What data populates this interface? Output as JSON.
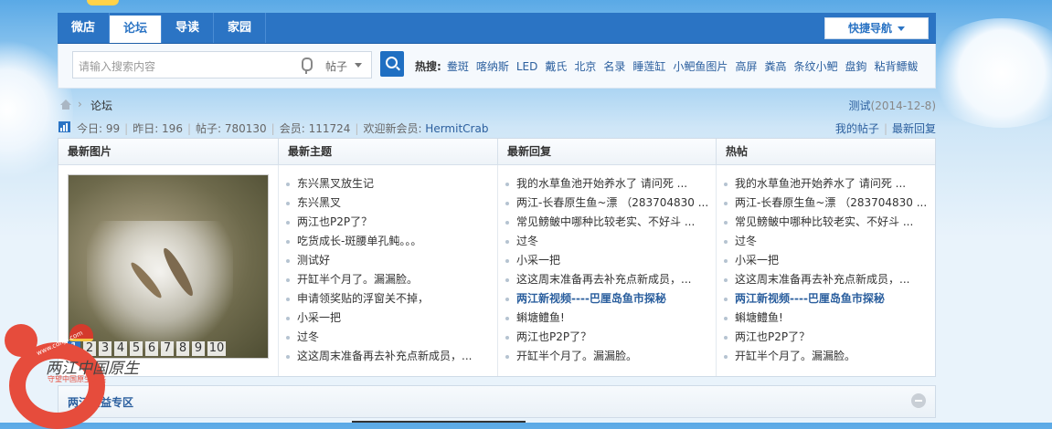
{
  "nav": {
    "tabs": [
      {
        "label": "微店"
      },
      {
        "label": "论坛",
        "active": true
      },
      {
        "label": "导读"
      },
      {
        "label": "家园"
      }
    ],
    "quick_nav": "快捷导航"
  },
  "search": {
    "placeholder": "请输入搜索内容",
    "scope": "帖子",
    "hot_label": "热搜:",
    "hot": [
      "鲞斑",
      "喀纳斯",
      "LED",
      "戴氏",
      "北京",
      "名录",
      "睡莲缸",
      "小鲃鱼图片",
      "高屏",
      "粪高",
      "条纹小鲃",
      "盘鉤",
      "粘背鳔鲅"
    ]
  },
  "breadcrumb": {
    "current": "论坛",
    "right_text": "测试",
    "right_date": "(2014-12-8)"
  },
  "stats": {
    "today": "今日: 99",
    "yesterday": "昨日: 196",
    "posts": "帖子: 780130",
    "members": "会员: 111724",
    "welcome": "欢迎新会员: ",
    "new_member": "HermitCrab",
    "my_posts": "我的帖子",
    "latest_reply": "最新回复"
  },
  "panel": {
    "headers": [
      "最新图片",
      "最新主题",
      "最新回复",
      "热帖"
    ],
    "pager": [
      "1",
      "2",
      "3",
      "4",
      "5",
      "6",
      "7",
      "8",
      "9",
      "10"
    ],
    "latest_topics": [
      "东兴黑叉放生记",
      "东兴黑叉",
      "两江也P2P了？",
      "吃货成长-斑腰单孔鲀。。。",
      "测试好",
      "开缸半个月了。漏漏脸。",
      "申请领奖贴的浮窗关不掉，",
      "小采一把",
      "过冬",
      "这这周末准备再去补充点新成员，..."
    ],
    "latest_replies": [
      "我的水草鱼池开始养水了 请问死 ...",
      "两江-长春原生鱼~漂 （283704830 ...",
      "常见鳑鲏中哪种比较老实、不好斗 ...",
      "过冬",
      "小采一把",
      "这这周末准备再去补充点新成员，...",
      "两江新视频----巴厘岛鱼市探秘",
      "蝌塘鳢鱼!",
      "两江也P2P了？",
      "开缸半个月了。漏漏脸。"
    ],
    "hot_posts": [
      "我的水草鱼池开始养水了 请问死 ...",
      "两江-长春原生鱼~漂 （283704830 ...",
      "常见鳑鲏中哪种比较老实、不好斗 ...",
      "过冬",
      "小采一把",
      "这这周末准备再去补充点新成员，...",
      "两江新视频----巴厘岛鱼市探秘",
      "蝌塘鳢鱼!",
      "两江也P2P了？",
      "开缸半个月了。漏漏脸。"
    ]
  },
  "section": {
    "title": "两江公益专区"
  },
  "logo": {
    "url": "www.cdhjo.com",
    "name": "两江中国原生",
    "slogan": "守望中国原生之美"
  },
  "colors": {
    "nav_blue": "#2b74c4",
    "link_blue": "#2b5f9e",
    "logo_red": "#e64c3c"
  }
}
